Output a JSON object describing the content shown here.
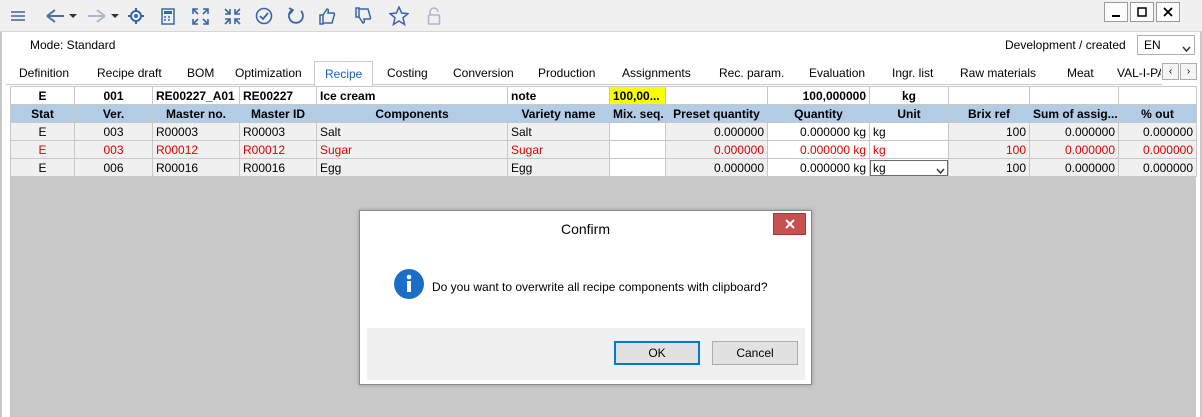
{
  "toolbar": {
    "icons": [
      "menu-icon",
      "back-icon",
      "back-dropdown-icon",
      "forward-icon",
      "forward-dropdown-icon",
      "settings-icon",
      "calculator-icon",
      "expand-icon",
      "collapse-icon",
      "check-icon",
      "refresh-icon",
      "thumbs-up-icon",
      "thumbs-down-icon",
      "star-icon",
      "lock-icon"
    ]
  },
  "header": {
    "mode": "Mode: Standard",
    "status": "Development / created",
    "language": "EN"
  },
  "tabs": [
    "Definition",
    "Recipe draft",
    "BOM",
    "Optimization",
    "Recipe",
    "Costing",
    "Conversion",
    "Production",
    "Assignments",
    "Rec. param.",
    "Evaluation",
    "Ingr. list",
    "Raw materials",
    "Meat",
    "VAL-I-PA"
  ],
  "active_tab": "Recipe",
  "grid": {
    "top_row": [
      "E",
      "001",
      "RE00227_A01",
      "RE00227",
      "Ice cream",
      "note",
      "100,00...",
      "",
      "100,000000",
      "kg",
      "",
      "",
      "",
      ""
    ],
    "columns": [
      "Stat",
      "Ver.",
      "Master no.",
      "Master ID",
      "Components",
      "Variety name",
      "Mix. seq.",
      "Preset quantity",
      "Quantity",
      "Unit",
      "Brix ref",
      "Sum of assig...",
      "% out"
    ],
    "rows": [
      [
        "E",
        "003",
        "R00003",
        "R00003",
        "Salt",
        "Salt",
        "",
        "0.000000",
        "0.000000 kg",
        "kg",
        "100",
        "0.000000",
        "0.000000"
      ],
      [
        "E",
        "003",
        "R00012",
        "R00012",
        "Sugar",
        "Sugar",
        "",
        "0.000000",
        "0.000000 kg",
        "kg",
        "100",
        "0.000000",
        "0.000000"
      ],
      [
        "E",
        "006",
        "R00016",
        "R00016",
        "Egg",
        "Egg",
        "",
        "0.000000",
        "0.000000 kg",
        "kg",
        "100",
        "0.000000",
        "0.000000"
      ]
    ],
    "highlight_color": "#e00000",
    "header_color": "#b2cce6",
    "yellow": "#f7ff00"
  },
  "dialog": {
    "title": "Confirm",
    "message": "Do you want to overwrite all recipe components with clipboard?",
    "ok": "OK",
    "cancel": "Cancel",
    "icon": "info-icon",
    "close_color": "#c75050"
  }
}
